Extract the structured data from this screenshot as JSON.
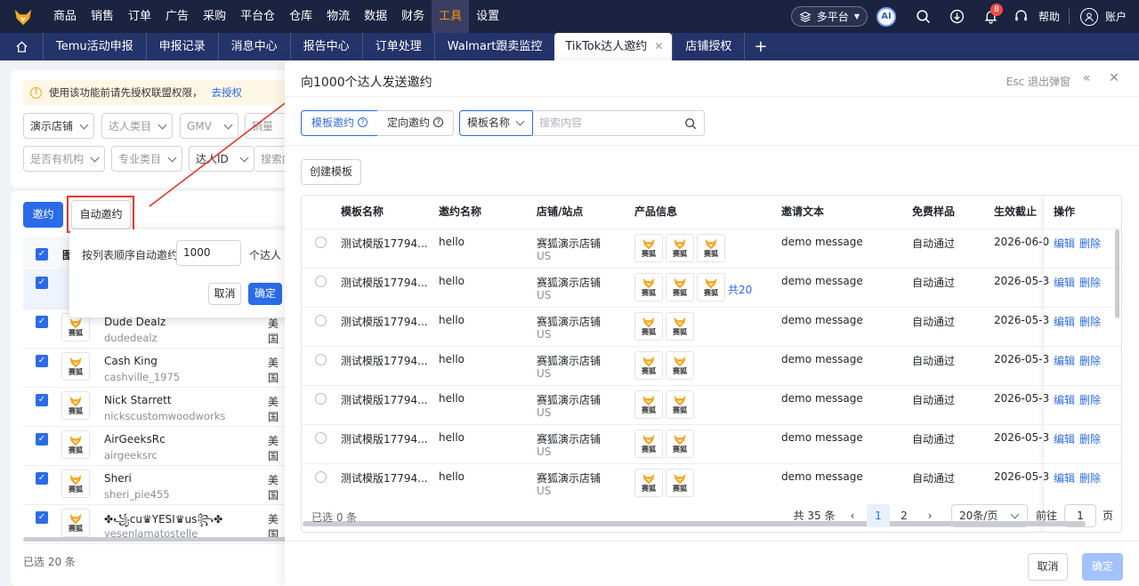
{
  "nav": {
    "menu": [
      "商品",
      "销售",
      "订单",
      "广告",
      "采购",
      "平台仓",
      "仓库",
      "物流",
      "数据",
      "财务",
      "工具",
      "设置"
    ],
    "active_index": 10,
    "platform_label": "多平台",
    "ai_label": "AI",
    "notification_count": "8",
    "help_label": "帮助",
    "account_label": "账户"
  },
  "tabs": [
    "Temu活动申报",
    "申报记录",
    "消息中心",
    "报告中心",
    "订单处理",
    "Walmart跟卖监控",
    "TikTok达人邀约",
    "店铺授权"
  ],
  "active_tab": "TikTok达人邀约",
  "bg": {
    "warning_text": "使用该功能前请先授权联盟权限，",
    "warning_link": "去授权",
    "filters_row1": [
      "演示店铺",
      "达人类目",
      "GMV",
      "销量"
    ],
    "filters_row2": [
      "是否有机构",
      "专业类目",
      "达人ID",
      "搜索内容"
    ],
    "invite_btn": "邀约",
    "auto_invite_btn": "自动邀约",
    "header_partial": "图",
    "creators": [
      {
        "name": "Dude Dealz",
        "handle": "dudedealz",
        "country": "美国"
      },
      {
        "name": "Cash King",
        "handle": "cashville_1975",
        "country": "美国"
      },
      {
        "name": "Nick Starrett",
        "handle": "nickscustomwoodworks",
        "country": "美国"
      },
      {
        "name": "AirGeeksRc",
        "handle": "airgeeksrc",
        "country": "美国"
      },
      {
        "name": "Sheri",
        "handle": "sheri_pie455",
        "country": "美国"
      },
      {
        "name": "✤꧁cu♛YESI♛us꧂✤",
        "handle": "yesenlamatostelle",
        "country": "美国"
      }
    ],
    "selected_text": "已选 20 条"
  },
  "popover": {
    "label": "按列表顺序自动邀约",
    "value": "1000",
    "unit": "个达人",
    "cancel": "取消",
    "ok": "确定"
  },
  "drawer": {
    "title": "向1000个达人发送邀约",
    "esc_text": "Esc 退出弹窗",
    "mode_template": "模板邀约",
    "mode_direct": "定向邀约",
    "search_field": "模板名称",
    "search_placeholder": "搜索内容",
    "create_btn": "创建模板",
    "columns": [
      "模板名称",
      "邀约名称",
      "店铺/站点",
      "产品信息",
      "邀请文本",
      "免费样品",
      "生效截止",
      "操作"
    ],
    "thumb_text": "赛狐",
    "rows": [
      {
        "tpl": "测试模版17794...",
        "invite": "hello",
        "shop": "赛狐演示店铺",
        "site": "US",
        "products": 3,
        "more": "",
        "text": "demo message",
        "sample": "自动通过",
        "expire": "2026-06-0"
      },
      {
        "tpl": "测试模版17794...",
        "invite": "hello",
        "shop": "赛狐演示店铺",
        "site": "US",
        "products": 3,
        "more": "共20",
        "text": "demo message",
        "sample": "自动通过",
        "expire": "2026-05-3"
      },
      {
        "tpl": "测试模版17794...",
        "invite": "hello",
        "shop": "赛狐演示店铺",
        "site": "US",
        "products": 2,
        "more": "",
        "text": "demo message",
        "sample": "自动通过",
        "expire": "2026-05-3"
      },
      {
        "tpl": "测试模版17794...",
        "invite": "hello",
        "shop": "赛狐演示店铺",
        "site": "US",
        "products": 2,
        "more": "",
        "text": "demo message",
        "sample": "自动通过",
        "expire": "2026-05-3"
      },
      {
        "tpl": "测试模版17794...",
        "invite": "hello",
        "shop": "赛狐演示店铺",
        "site": "US",
        "products": 2,
        "more": "",
        "text": "demo message",
        "sample": "自动通过",
        "expire": "2026-05-3"
      },
      {
        "tpl": "测试模版17794...",
        "invite": "hello",
        "shop": "赛狐演示店铺",
        "site": "US",
        "products": 2,
        "more": "",
        "text": "demo message",
        "sample": "自动通过",
        "expire": "2026-05-3"
      },
      {
        "tpl": "测试模版17794...",
        "invite": "hello",
        "shop": "赛狐演示店铺",
        "site": "US",
        "products": 2,
        "more": "",
        "text": "demo message",
        "sample": "自动通过",
        "expire": "2026-05-3"
      }
    ],
    "edit": "编辑",
    "delete": "删除",
    "selected_text": "已选 0 条",
    "total_text": "共 35 条",
    "pages": [
      "1",
      "2"
    ],
    "current_page": "1",
    "page_size": "20条/页",
    "goto_label": "前往",
    "goto_value": "1",
    "page_unit": "页",
    "cancel": "取消",
    "ok": "确定"
  },
  "colors": {
    "nav_bg": "#1b2340",
    "tab_bg": "#24336a",
    "accent": "#2b6bea",
    "active_menu": "#ff9500",
    "annotation_red": "#e8362a"
  }
}
